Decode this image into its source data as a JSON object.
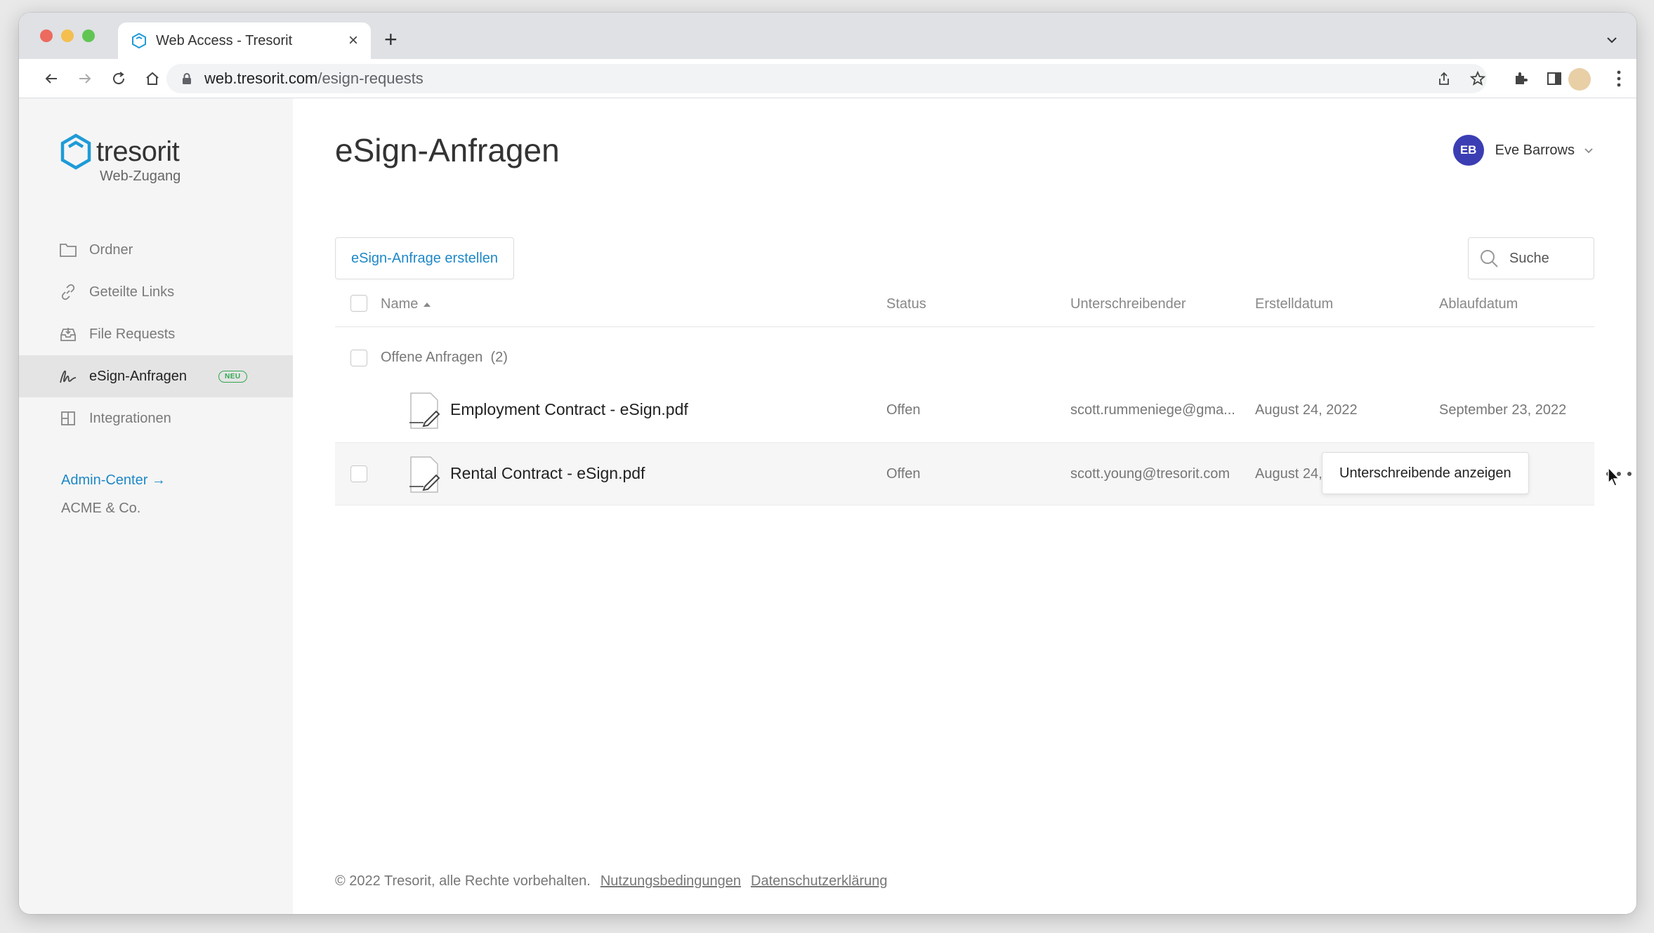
{
  "browser": {
    "tab_title": "Web Access - Tresorit",
    "url_domain": "web.tresorit.com",
    "url_path": "/esign-requests"
  },
  "sidebar": {
    "logo_text": "tresorit",
    "logo_subtitle": "Web-Zugang",
    "items": [
      {
        "label": "Ordner",
        "icon": "folder-icon"
      },
      {
        "label": "Geteilte Links",
        "icon": "link-icon"
      },
      {
        "label": "File Requests",
        "icon": "inbox-icon"
      },
      {
        "label": "eSign-Anfragen",
        "icon": "signature-icon",
        "badge": "NEU",
        "active": true
      },
      {
        "label": "Integrationen",
        "icon": "integrations-icon"
      }
    ],
    "admin_link": "Admin-Center →",
    "org_name": "ACME & Co."
  },
  "header": {
    "title": "eSign-Anfragen",
    "user_initials": "EB",
    "user_name": "Eve Barrows"
  },
  "actions": {
    "create_label": "eSign-Anfrage erstellen",
    "search_placeholder": "Suche"
  },
  "table": {
    "columns": [
      "Name",
      "Status",
      "Unterschreibender",
      "Erstelldatum",
      "Ablaufdatum"
    ],
    "group_label": "Offene Anfragen",
    "group_count": "(2)",
    "rows": [
      {
        "name": "Employment Contract - eSign.pdf",
        "status": "Offen",
        "signer": "scott.rummeniege@gma...",
        "created": "August 24, 2022",
        "expires": "September 23, 2022"
      },
      {
        "name": "Rental Contract - eSign.pdf",
        "status": "Offen",
        "signer": "scott.young@tresorit.com",
        "created": "August 24, 2"
      }
    ],
    "row_action_tooltip": "Unterschreibende anzeigen"
  },
  "footer": {
    "copyright": "© 2022 Tresorit, alle Rechte vorbehalten.",
    "terms": "Nutzungsbedingungen",
    "privacy": "Datenschutzerklärung"
  },
  "colors": {
    "accent": "#1e88c7",
    "avatar": "#3b3eb3",
    "badge": "#2fa84f"
  }
}
